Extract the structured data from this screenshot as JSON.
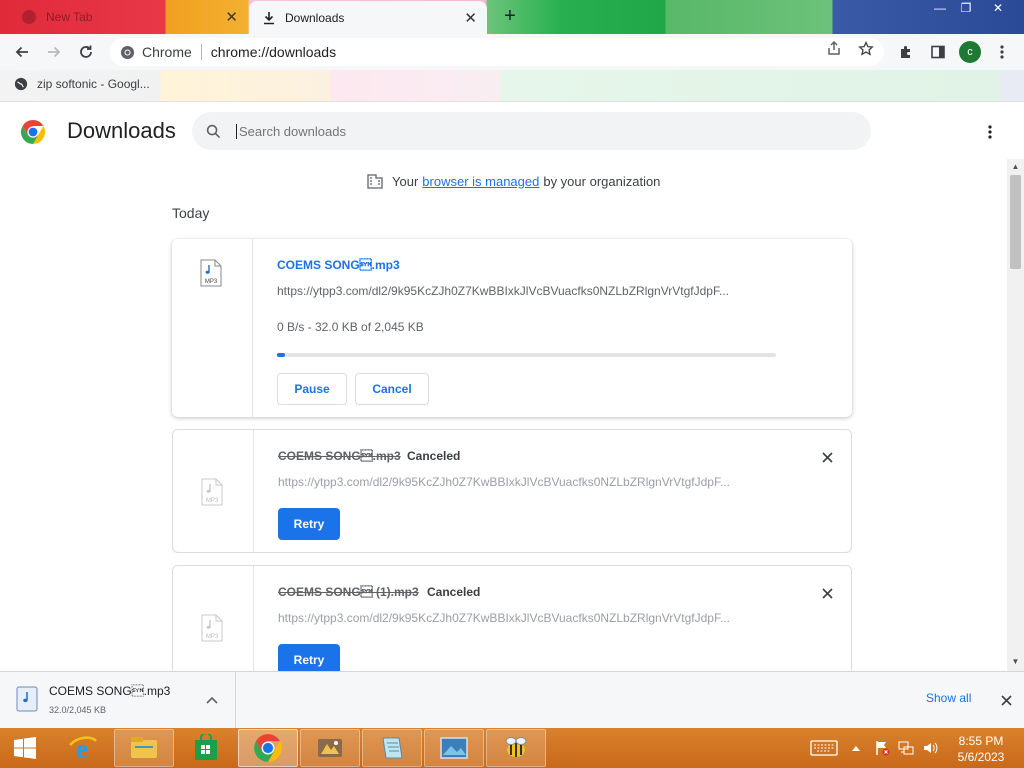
{
  "window": {
    "tabs": [
      {
        "label": "New Tab",
        "active": false
      },
      {
        "label": "Downloads",
        "active": true
      }
    ],
    "new_tab_symbol": "+",
    "controls": {
      "minimize": "—",
      "restore": "❐",
      "close": "✕"
    }
  },
  "toolbar": {
    "site_chip": "Chrome",
    "url": "chrome://downloads",
    "profile_initial": "c"
  },
  "bookmarks": [
    {
      "label": "zip softonic - Googl...",
      "icon": "google-favicon"
    }
  ],
  "page": {
    "title": "Downloads",
    "search_placeholder": "Search downloads",
    "managed_notice": {
      "prefix": "Your",
      "link": "browser is managed",
      "suffix": "by your organization"
    },
    "section_label": "Today"
  },
  "downloads": [
    {
      "file_name": "COEMS SONG\u0016.mp3",
      "file_icon": "mp3-file-icon",
      "url": "https://ytpp3.com/dl2/9k95KcZJh0Z7KwBBIxkJlVcBVuacfks0NZLbZRlgnVrVtgfJdpF...",
      "progress_text": "0 B/s - 32.0 KB of 2,045 KB",
      "progress_fraction": 0.016,
      "state": "in-progress",
      "buttons": [
        "Pause",
        "Cancel"
      ]
    },
    {
      "file_name": "COEMS SONG\u0016.mp3",
      "file_icon": "mp3-file-icon",
      "url": "https://ytpp3.com/dl2/9k95KcZJh0Z7KwBBIxkJlVcBVuacfks0NZLbZRlgnVrVtgfJdpF...",
      "status": "Canceled",
      "state": "canceled",
      "buttons": [
        "Retry"
      ]
    },
    {
      "file_name": "COEMS SONG\u0016 (1).mp3",
      "file_icon": "mp3-file-icon",
      "url": "https://ytpp3.com/dl2/9k95KcZJh0Z7KwBBIxkJlVcBVuacfks0NZLbZRlgnVrVtgfJdpF...",
      "status": "Canceled",
      "state": "canceled",
      "buttons": [
        "Retry"
      ]
    }
  ],
  "shelf": {
    "item": {
      "file_name": "COEMS SONG\u0016.mp3",
      "size_text": "32.0/2,045 KB"
    },
    "show_all": "Show all"
  },
  "taskbar": {
    "clock_time": "8:55 PM",
    "clock_date": "5/6/2023",
    "apps": [
      "start-button",
      "internet-explorer-icon",
      "file-explorer-icon",
      "store-icon",
      "chrome-icon",
      "app-icon",
      "notepad-icon",
      "photos-icon",
      "bee-app-icon"
    ]
  },
  "colors": {
    "accent": "#1a73e8",
    "taskbar": "#c8691a",
    "profile_avatar": "#1e7a32"
  }
}
